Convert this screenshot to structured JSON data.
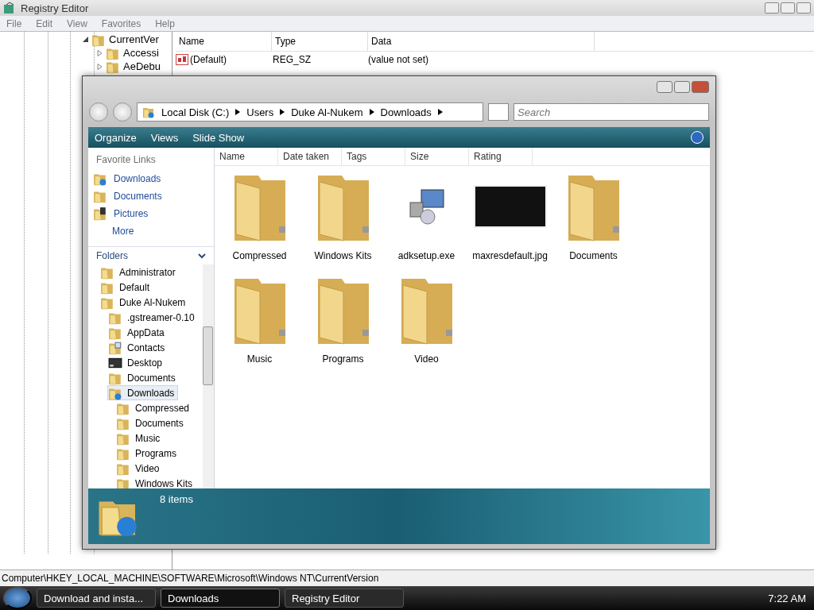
{
  "registry_window": {
    "title": "Registry Editor",
    "menu": [
      "File",
      "Edit",
      "View",
      "Favorites",
      "Help"
    ],
    "tree": [
      {
        "label": "CurrentVer",
        "expanded": true
      },
      {
        "label": "Accessi",
        "expanded": false
      },
      {
        "label": "AeDebu",
        "expanded": false
      }
    ],
    "columns": [
      "Name",
      "Type",
      "Data"
    ],
    "rows": [
      {
        "name": "(Default)",
        "type": "REG_SZ",
        "data": "(value not set)"
      }
    ],
    "status_bar": "Computer\\HKEY_LOCAL_MACHINE\\SOFTWARE\\Microsoft\\Windows NT\\CurrentVersion"
  },
  "explorer_window": {
    "breadcrumb": [
      "Local Disk (C:)",
      "Users",
      "Duke Al-Nukem",
      "Downloads"
    ],
    "search": {
      "placeholder": "Search"
    },
    "toolbar": [
      "Organize",
      "Views",
      "Slide Show"
    ],
    "favorite_links": {
      "title": "Favorite Links",
      "items": [
        {
          "label": "Downloads",
          "kind": "downloads"
        },
        {
          "label": "Documents",
          "kind": "folder"
        },
        {
          "label": "Pictures",
          "kind": "pictures"
        }
      ],
      "more": "More"
    },
    "folders": {
      "title": "Folders",
      "tree": [
        {
          "label": "Administrator",
          "selected": false
        },
        {
          "label": "Default",
          "selected": false
        },
        {
          "label": "Duke Al-Nukem",
          "selected": false,
          "children": [
            {
              "label": ".gstreamer-0.10",
              "kind": "folder",
              "selected": false
            },
            {
              "label": "AppData",
              "kind": "folder",
              "selected": false
            },
            {
              "label": "Contacts",
              "kind": "contacts",
              "selected": false
            },
            {
              "label": "Desktop",
              "kind": "desktop",
              "selected": false
            },
            {
              "label": "Documents",
              "kind": "folder",
              "selected": false
            },
            {
              "label": "Downloads",
              "kind": "downloads",
              "selected": true,
              "children": [
                {
                  "label": "Compressed",
                  "selected": false
                },
                {
                  "label": "Documents",
                  "selected": false
                },
                {
                  "label": "Music",
                  "selected": false
                },
                {
                  "label": "Programs",
                  "selected": false
                },
                {
                  "label": "Video",
                  "selected": false
                },
                {
                  "label": "Windows Kits",
                  "selected": false
                }
              ]
            }
          ]
        }
      ]
    },
    "columns": [
      "Name",
      "Date taken",
      "Tags",
      "Size",
      "Rating"
    ],
    "items": [
      {
        "label": "Compressed",
        "kind": "folder"
      },
      {
        "label": "Windows Kits",
        "kind": "folder"
      },
      {
        "label": "adksetup.exe",
        "kind": "installer"
      },
      {
        "label": "maxresdefault.jpg",
        "kind": "image"
      },
      {
        "label": "Documents",
        "kind": "folder"
      },
      {
        "label": "Music",
        "kind": "folder"
      },
      {
        "label": "Programs",
        "kind": "folder"
      },
      {
        "label": "Video",
        "kind": "folder"
      }
    ],
    "details": "8 items"
  },
  "taskbar": {
    "buttons": [
      {
        "label": "Download and insta...",
        "selected": false
      },
      {
        "label": "Downloads",
        "selected": true
      },
      {
        "label": "Registry Editor",
        "selected": false
      }
    ],
    "clock": "7:22 AM"
  }
}
